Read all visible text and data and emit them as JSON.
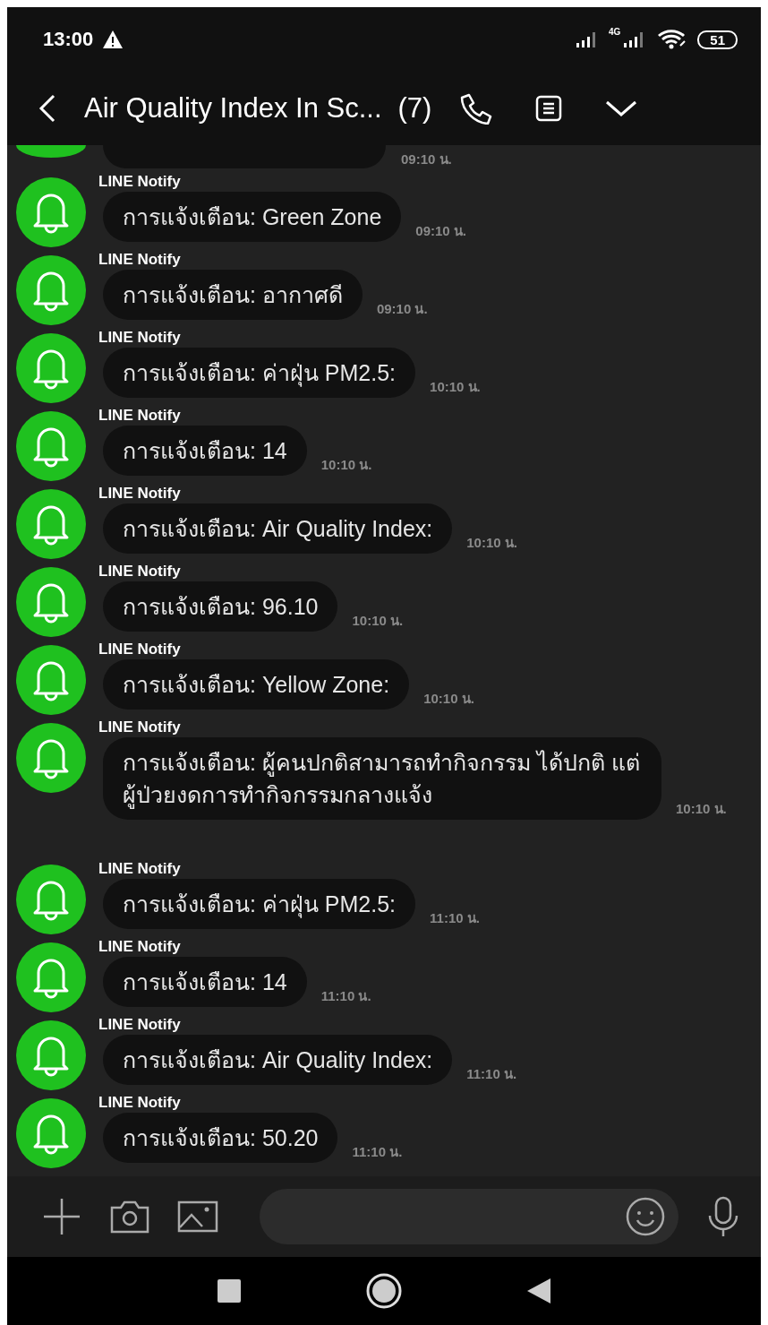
{
  "status_bar": {
    "time": "13:00",
    "network": "4G",
    "battery": "51"
  },
  "header": {
    "title": "Air Quality Index In Sc...",
    "member_count": "(7)"
  },
  "partial_message": {
    "time": "09:10 น."
  },
  "messages": [
    {
      "sender": "LINE Notify",
      "text": "การแจ้งเตือน: Green Zone",
      "time": "09:10 น."
    },
    {
      "sender": "LINE Notify",
      "text": "การแจ้งเตือน: อากาศดี",
      "time": "09:10 น."
    },
    {
      "sender": "LINE Notify",
      "text": "การแจ้งเตือน: ค่าฝุ่น PM2.5:",
      "time": "10:10 น."
    },
    {
      "sender": "LINE Notify",
      "text": "การแจ้งเตือน: 14",
      "time": "10:10 น."
    },
    {
      "sender": "LINE Notify",
      "text": "การแจ้งเตือน: Air Quality Index:",
      "time": "10:10 น."
    },
    {
      "sender": "LINE Notify",
      "text": "การแจ้งเตือน: 96.10",
      "time": "10:10 น."
    },
    {
      "sender": "LINE Notify",
      "text": "การแจ้งเตือน: Yellow Zone:",
      "time": "10:10 น."
    },
    {
      "sender": "LINE Notify",
      "text": "การแจ้งเตือน: ผู้คนปกติสามารถทำกิจกรรม ได้ปกติ แต่ ผู้ป่วยงดการทำกิจกรรมกลางแจ้ง",
      "time": "10:10 น."
    },
    {
      "sender": "LINE Notify",
      "text": "การแจ้งเตือน: ค่าฝุ่น PM2.5:",
      "time": "11:10 น."
    },
    {
      "sender": "LINE Notify",
      "text": "การแจ้งเตือน: 14",
      "time": "11:10 น."
    },
    {
      "sender": "LINE Notify",
      "text": "การแจ้งเตือน: Air Quality Index:",
      "time": "11:10 น."
    },
    {
      "sender": "LINE Notify",
      "text": "การแจ้งเตือน: 50.20",
      "time": "11:10 น."
    }
  ]
}
